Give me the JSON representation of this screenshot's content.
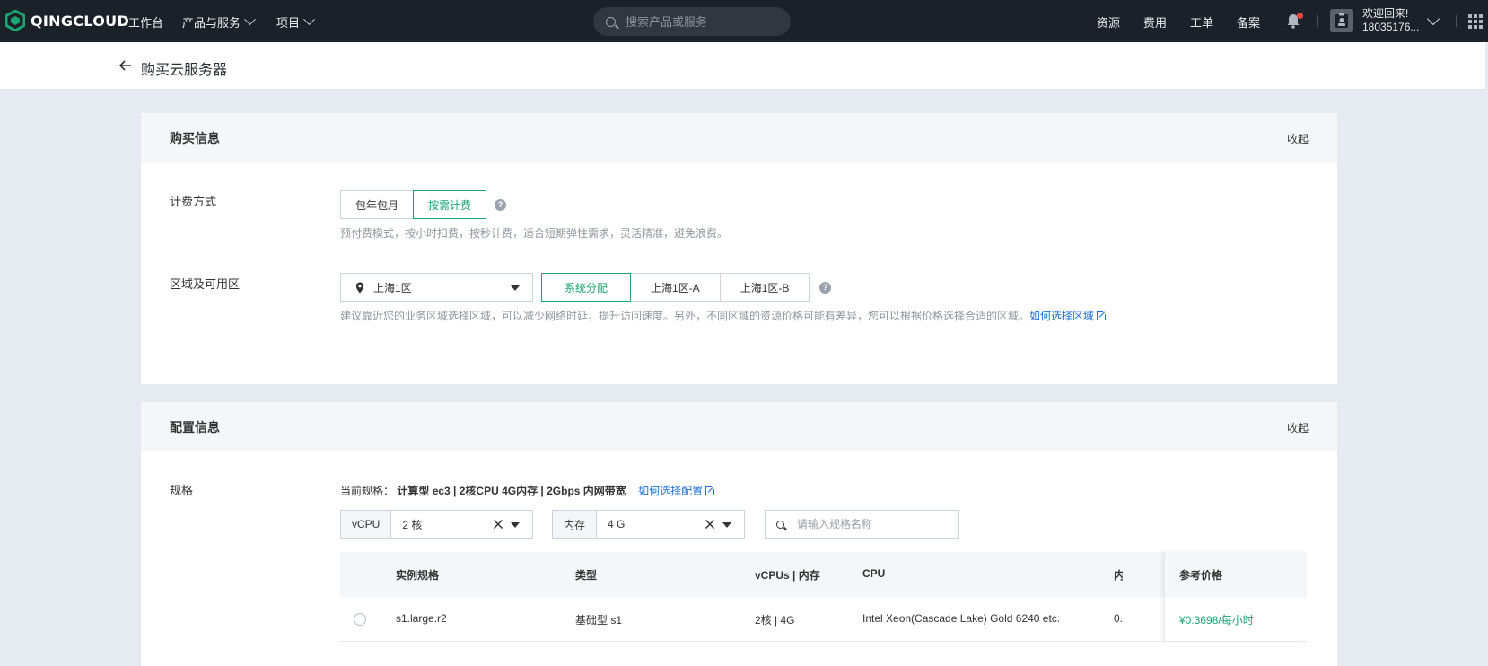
{
  "nav": {
    "brand": "QINGCLOUD",
    "workbench": "工作台",
    "products": "产品与服务",
    "projects": "项目",
    "search_placeholder": "搜索产品或服务",
    "resources": "资源",
    "billing": "费用",
    "tickets": "工单",
    "filing": "备案",
    "welcome": "欢迎回来!",
    "user_id": "18035176..."
  },
  "page": {
    "title": "购买云服务器"
  },
  "purchase": {
    "title": "购买信息",
    "collapse": "收起",
    "billing_label": "计费方式",
    "billing_options": [
      "包年包月",
      "按需计费"
    ],
    "billing_selected": "按需计费",
    "billing_hint": "预付费模式，按小时扣费，按秒计费，适合短期弹性需求，灵活精准，避免浪费。",
    "region_label": "区域及可用区",
    "region_value": "上海1区",
    "zone_options": [
      "系统分配",
      "上海1区-A",
      "上海1区-B"
    ],
    "zone_selected": "系统分配",
    "region_hint": "建议靠近您的业务区域选择区域，可以减少网络时延，提升访问速度。另外，不同区域的资源价格可能有差异，您可以根据价格选择合适的区域。",
    "region_link": "如何选择区域"
  },
  "config": {
    "title": "配置信息",
    "collapse": "收起",
    "spec_label": "规格",
    "current_spec_prefix": "当前规格：",
    "current_spec": "计算型 ec3 | 2核CPU 4G内存 | 2Gbps 内网带宽",
    "spec_link": "如何选择配置",
    "vcpu_label": "vCPU",
    "vcpu_value": "2 核",
    "memory_label": "内存",
    "memory_value": "4 G",
    "spec_search_placeholder": "请输入规格名称",
    "table": {
      "headers": [
        "实例规格",
        "类型",
        "vCPUs | 内存",
        "CPU",
        "内",
        "参考价格"
      ],
      "rows": [
        {
          "spec": "s1.large.r2",
          "type": "基础型 s1",
          "vcpu_mem": "2核 | 4G",
          "cpu": "Intel Xeon(Cascade Lake) Gold 6240 etc.",
          "partial": "0.",
          "price": "¥0.3698/每小时"
        }
      ]
    }
  },
  "colors": {
    "accent_green": "#19a672",
    "link_blue": "#1a6fd8",
    "topnav_bg": "#1b2129"
  }
}
